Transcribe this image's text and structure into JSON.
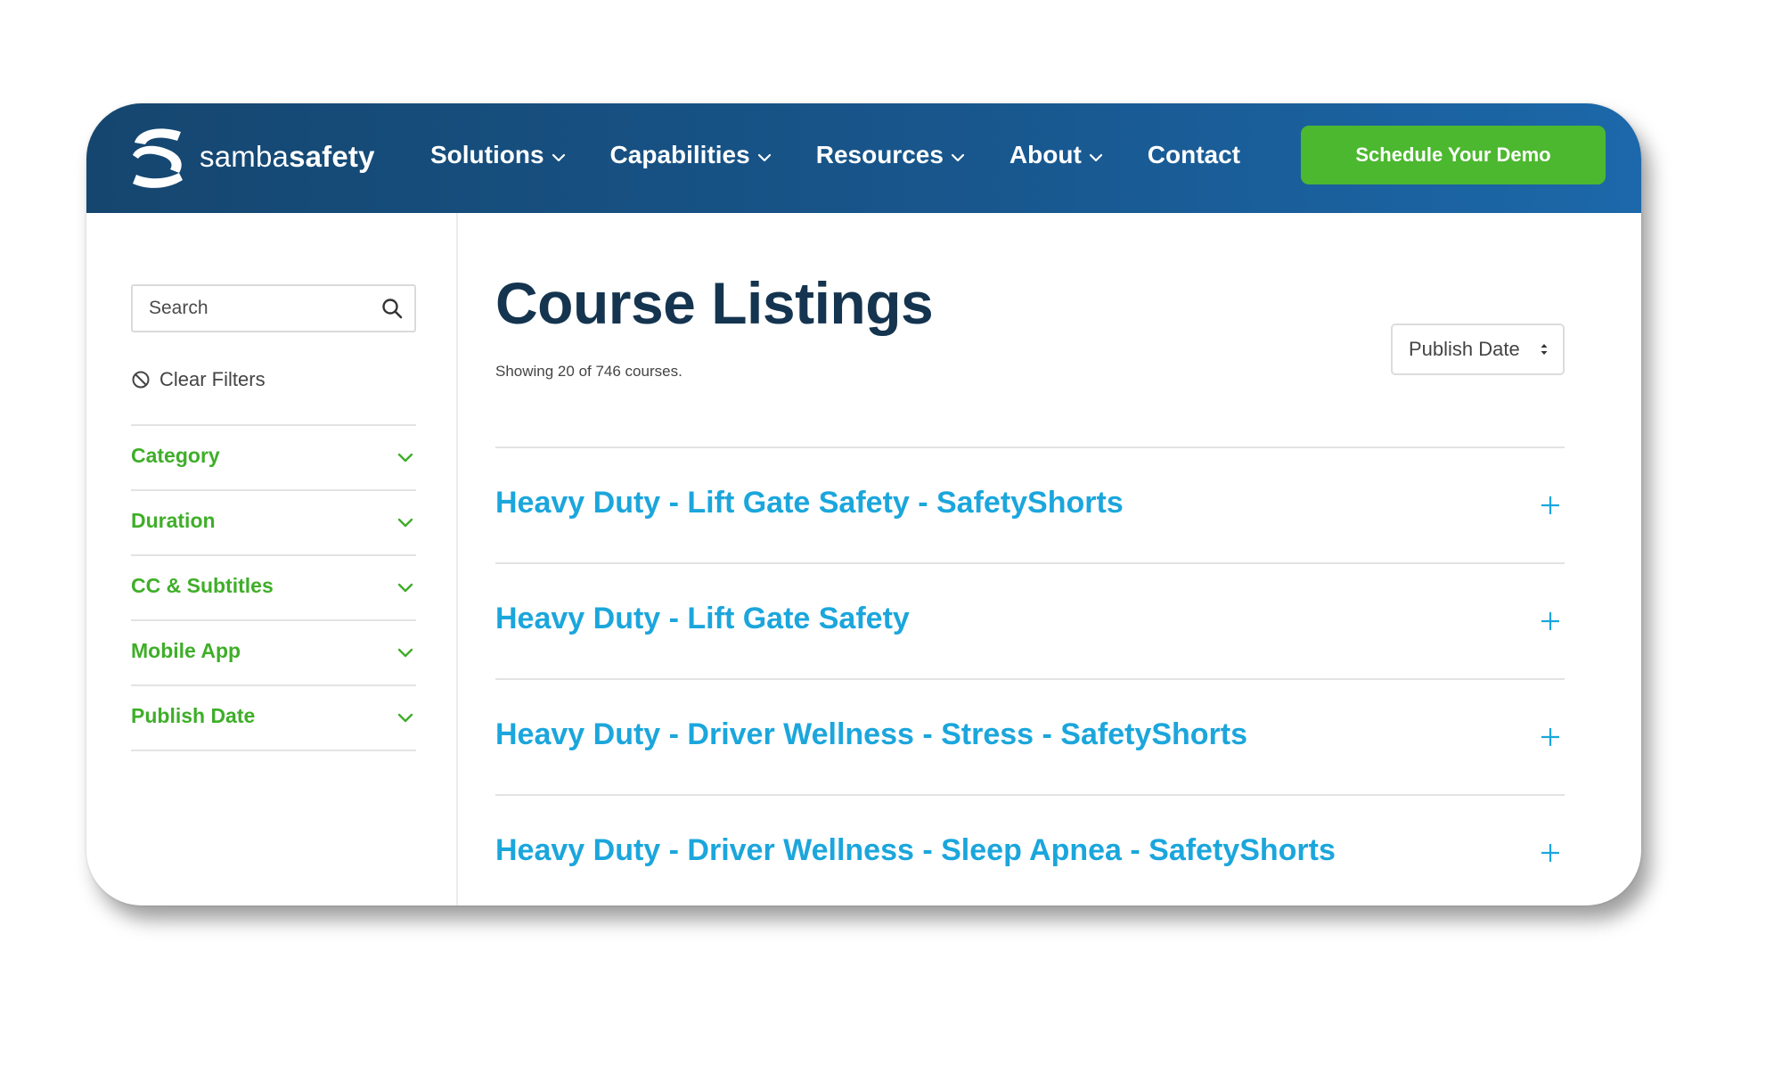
{
  "brand": {
    "name_light": "samba",
    "name_bold": "safety",
    "logo_icon": "samba-s-logo-icon"
  },
  "nav": {
    "items": [
      {
        "label": "Solutions",
        "has_dropdown": true
      },
      {
        "label": "Capabilities",
        "has_dropdown": true
      },
      {
        "label": "Resources",
        "has_dropdown": true
      },
      {
        "label": "About",
        "has_dropdown": true
      },
      {
        "label": "Contact",
        "has_dropdown": false
      }
    ],
    "cta_label": "Schedule Your Demo"
  },
  "sidebar": {
    "search": {
      "placeholder": "Search",
      "value": ""
    },
    "clear_filters_label": "Clear Filters",
    "filters": [
      {
        "label": "Category"
      },
      {
        "label": "Duration"
      },
      {
        "label": "CC & Subtitles"
      },
      {
        "label": "Mobile App"
      },
      {
        "label": "Publish Date"
      }
    ]
  },
  "main": {
    "title": "Course Listings",
    "showing_text": "Showing 20 of 746 courses.",
    "sort": {
      "selected": "Publish Date"
    },
    "courses": [
      {
        "title": "Heavy Duty - Lift Gate Safety - SafetyShorts"
      },
      {
        "title": "Heavy Duty - Lift Gate Safety"
      },
      {
        "title": "Heavy Duty - Driver Wellness - Stress - SafetyShorts"
      },
      {
        "title": "Heavy Duty - Driver Wellness - Sleep Apnea - SafetyShorts"
      }
    ]
  },
  "colors": {
    "nav_start": "#15466f",
    "nav_end": "#1c68aa",
    "cta_green": "#4cb82f",
    "filter_green": "#3fae29",
    "course_blue": "#1ba6dc",
    "title_navy": "#14344f"
  }
}
